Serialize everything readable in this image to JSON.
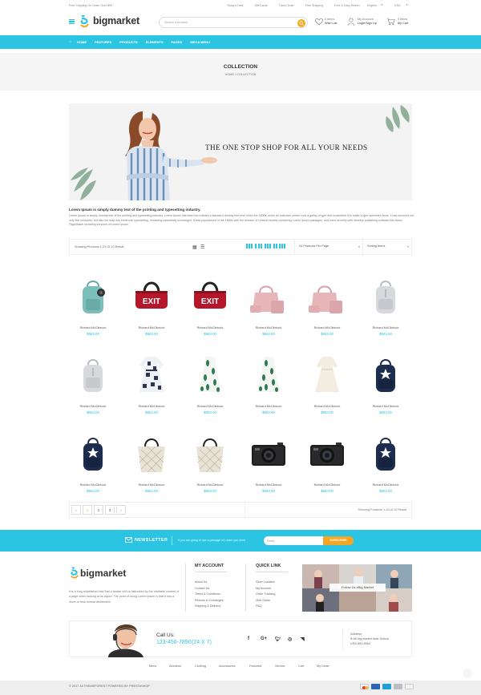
{
  "topbar": {
    "shipping": "Free Shipping On Order Over $99",
    "links": [
      "Today's Deal",
      "Gift Cards",
      "Track Order",
      "Free Shipping",
      "Free & Easy Return"
    ],
    "language": "English",
    "currency": "USD"
  },
  "header": {
    "logo": "bigmarket",
    "search_placeholder": "Search a product",
    "wishlist_count": "0 items",
    "wishlist_label": "Wish List",
    "account_label": "My Account",
    "account_action": "Login/Sign Up",
    "cart_count": "0 items",
    "cart_label": "My Cart"
  },
  "nav": [
    "HOME",
    "FEATURES",
    "PRODUCTS",
    "ELEMENTS",
    "PAGES",
    "MEGA MENU"
  ],
  "page": {
    "title": "COLLECTION",
    "breadcrumb": "HOME  /  COLLECTION"
  },
  "banner": {
    "tagline": "THE ONE STOP SHOP FOR ALL YOUR NEEDS"
  },
  "description": {
    "title": "Lorem Ipsum is simply dummy text of the printing and typesetting industry.",
    "body": "Lorem Ipsum is simply dummy text of the printing and typesetting industry. Lorem Ipsum has been the industry's standard dummy text ever since the 1500s, when an unknown printer took a galley of type and scrambled it to make a type specimen book. It has survived not only five centuries, but also the leap into electronic typesetting, remaining essentially unchanged. It was popularised in the 1960s with the release of Letraset sheets containing Lorem Ipsum passages, and more recently with desktop publishing software like Aldus PageMaker including versions of Lorem Ipsum."
  },
  "toolbar": {
    "showing": "Showing Products 1-24 Of 10 Result",
    "per_page": "24 Products Per Page",
    "sorting": "Sorting Items"
  },
  "products": [
    {
      "name": "Richard McClintock",
      "price": "$963.00",
      "kind": "backpack-teal"
    },
    {
      "name": "Richard McClintock",
      "price": "$963.00",
      "kind": "exit-bag"
    },
    {
      "name": "Richard McClintock",
      "price": "$963.00",
      "kind": "exit-bag"
    },
    {
      "name": "Richard McClintock",
      "price": "$963.00",
      "kind": "pink-bags"
    },
    {
      "name": "Richard McClintock",
      "price": "$963.00",
      "kind": "pink-bags"
    },
    {
      "name": "Richard McClintock",
      "price": "$963.00",
      "kind": "backpack-grey"
    },
    {
      "name": "Richard McClintock",
      "price": "$963.00",
      "kind": "backpack-grey"
    },
    {
      "name": "Richard McClintock",
      "price": "$963.00",
      "kind": "dress-print"
    },
    {
      "name": "Richard McClintock",
      "price": "$963.00",
      "kind": "dress-green"
    },
    {
      "name": "Richard McClintock",
      "price": "$963.00",
      "kind": "dress-green"
    },
    {
      "name": "Richard McClintock",
      "price": "$963.00",
      "kind": "dress-white"
    },
    {
      "name": "Richard McClintock",
      "price": "$963.00",
      "kind": "backpack-navy"
    },
    {
      "name": "Richard McClintock",
      "price": "$963.00",
      "kind": "backpack-navy"
    },
    {
      "name": "Richard McClintock",
      "price": "$963.00",
      "kind": "tote"
    },
    {
      "name": "Richard McClintock",
      "price": "$963.00",
      "kind": "tote"
    },
    {
      "name": "Richard McClintock",
      "price": "$963.00",
      "kind": "camera"
    },
    {
      "name": "Richard McClintock",
      "price": "$963.00",
      "kind": "camera"
    },
    {
      "name": "Richard McClintock",
      "price": "$963.00",
      "kind": "backpack-navy"
    }
  ],
  "pagination": {
    "pages": [
      "‹",
      "1",
      "2",
      "3",
      "›"
    ],
    "active": "1",
    "info": "Showing Products 1-24 of 10 Result"
  },
  "newsletter": {
    "title": "NEWSLETTER",
    "text": "If you are going to use a passage of Lorem you need",
    "placeholder": "Email...",
    "button": "SUBSCRIBE"
  },
  "footer": {
    "logo": "bigmarket",
    "about": "It is a long established fact that a reader will be distracted by the readable content of a page when looking at its layout. The point of using Lorem Ipsum is that it has a more-or-less normal distribution",
    "account_title": "MY ACCOUNT",
    "account_links": [
      "About Us",
      "Contact Us",
      "Terms & Conditions",
      "Returns & Exchanges",
      "Shipping & Delivery"
    ],
    "quick_title": "QUICK LINK",
    "quick_links": [
      "Store Location",
      "My Account",
      "Order Tracking",
      "Size Guide",
      "FAQ"
    ],
    "instagram": "Follow Us #Big Market",
    "call_us": "Call Us:",
    "phone": "123-456-7890",
    "phone_hours": "(24 X 7)",
    "address_label": "Address:",
    "address_line1": "B-56 big market near School",
    "address_line2": "USA-653-8964",
    "social_icons": [
      "facebook-icon",
      "google-plus-icon",
      "twitter-icon",
      "instagram-icon",
      "rss-icon"
    ],
    "bottom_links": [
      "Mens",
      "Womens",
      "Clothing",
      "Accessories",
      "Featured",
      "Service",
      "Cart",
      "My Order"
    ],
    "copyright": "© 2017-18 THEMEFOREST POWERED BY PRESTASHOP"
  },
  "colors": {
    "accent": "#2cc4e3",
    "orange": "#f6a623"
  }
}
